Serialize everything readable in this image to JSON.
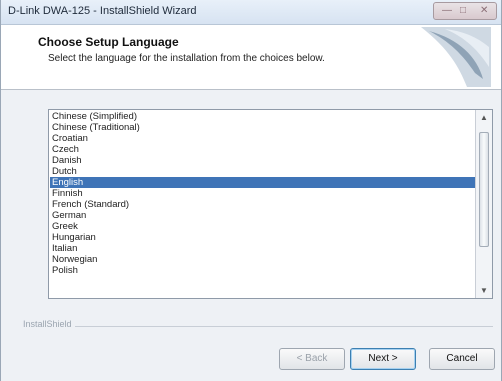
{
  "window": {
    "title": "D-Link DWA-125 - InstallShield Wizard"
  },
  "header": {
    "title": "Choose Setup Language",
    "subtitle": "Select the language for the installation from the choices below."
  },
  "languages": {
    "items": [
      "Chinese (Simplified)",
      "Chinese (Traditional)",
      "Croatian",
      "Czech",
      "Danish",
      "Dutch",
      "English",
      "Finnish",
      "French (Standard)",
      "German",
      "Greek",
      "Hungarian",
      "Italian",
      "Norwegian",
      "Polish"
    ],
    "selected": "English"
  },
  "footer": {
    "brand": "InstallShield"
  },
  "buttons": {
    "back": "< Back",
    "next": "Next >",
    "cancel": "Cancel"
  },
  "colors": {
    "selection": "#3f74b7",
    "window_bg": "#eef1f5"
  }
}
